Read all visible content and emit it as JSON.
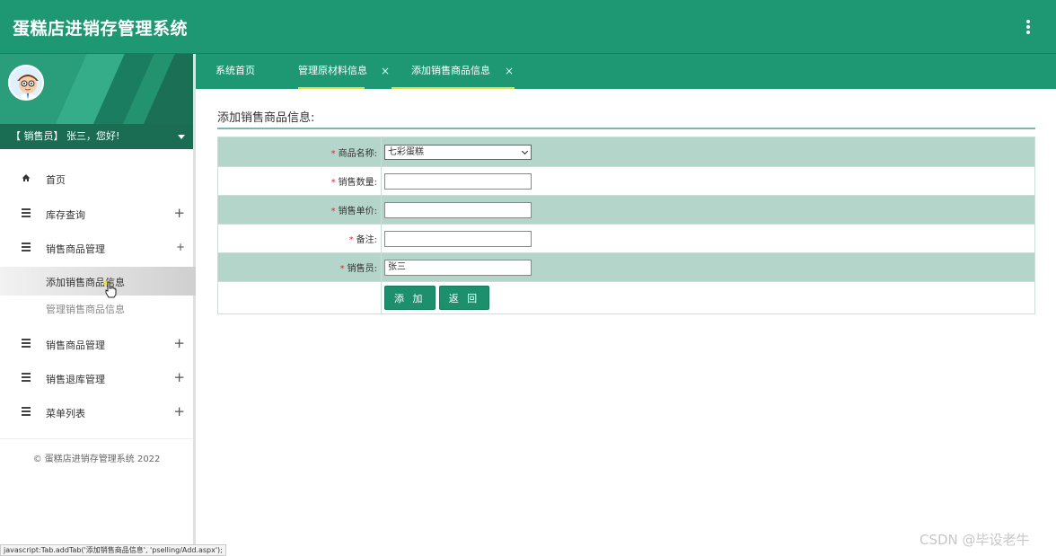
{
  "app": {
    "title": "蛋糕店进销存管理系统"
  },
  "user": {
    "greeting": "【 销售员】 张三，您好!"
  },
  "sidebar": {
    "items": [
      {
        "label": "首页"
      },
      {
        "label": "库存查询"
      },
      {
        "label": "销售商品管理"
      },
      {
        "label": "销售商品管理"
      },
      {
        "label": "销售退库管理"
      },
      {
        "label": "菜单列表"
      }
    ],
    "subitems": [
      {
        "label": "添加销售商品信息"
      },
      {
        "label": "管理销售商品信息"
      }
    ],
    "copyright": "© 蛋糕店进销存管理系统 2022"
  },
  "tabs": [
    {
      "label": "系统首页"
    },
    {
      "label": "管理原材料信息",
      "close": "×"
    },
    {
      "label": "添加销售商品信息",
      "close": "×"
    }
  ],
  "form": {
    "title": "添加销售商品信息:",
    "required_mark": "*",
    "fields": [
      {
        "label": "商品名称:",
        "value": "七彩蛋糕"
      },
      {
        "label": "销售数量:",
        "value": ""
      },
      {
        "label": "销售单价:",
        "value": ""
      },
      {
        "label": "备注:",
        "value": ""
      },
      {
        "label": "销售员:",
        "value": "张三"
      }
    ],
    "buttons": {
      "add": "添 加",
      "back": "返 回"
    }
  },
  "status_bar": "javascript:Tab.addTab('添加销售商品信息', 'pselling/Add.aspx');",
  "watermark": "CSDN @毕设老牛",
  "colors": {
    "primary": "#1e9873",
    "row_shade": "#b4d5c9",
    "tab_underline": "#e6d94a"
  }
}
